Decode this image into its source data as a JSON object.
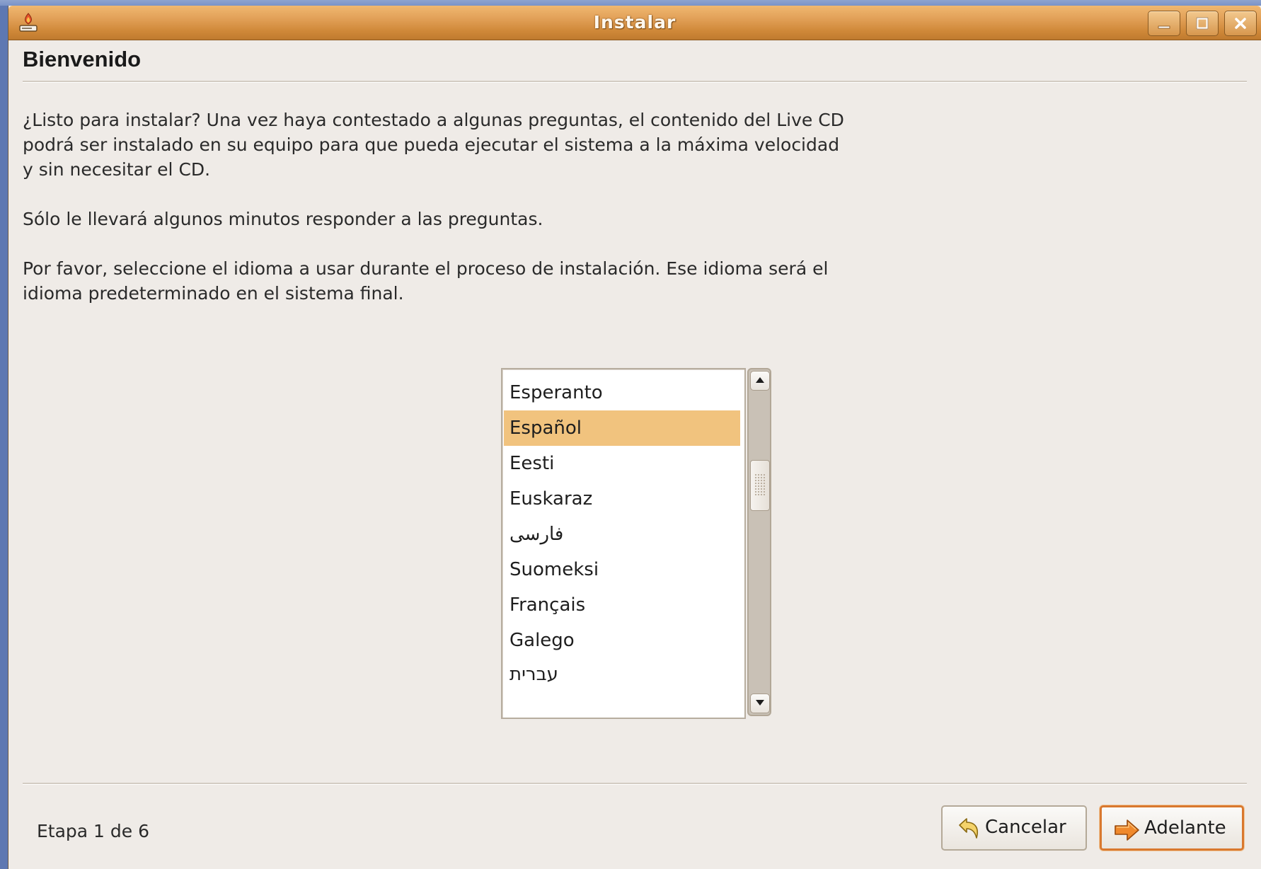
{
  "window": {
    "title": "Instalar"
  },
  "header": {
    "page_title": "Bienvenido"
  },
  "intro": {
    "paragraph1_line1": "¿Listo para instalar? Una vez haya contestado a algunas preguntas, el contenido del Live CD",
    "paragraph1_line2": "podrá ser instalado en su equipo para que pueda ejecutar el sistema a la máxima velocidad",
    "paragraph1_line3": "y sin necesitar el CD.",
    "paragraph2": "Sólo le llevará algunos minutos responder a las preguntas.",
    "paragraph3_line1": "Por favor, seleccione el idioma a usar durante el proceso de instalación. Ese idioma será el",
    "paragraph3_line2": "idioma predeterminado en el sistema final."
  },
  "language_list": {
    "selected": "Español",
    "items": [
      "Esperanto",
      "Español",
      "Eesti",
      "Euskaraz",
      "فارسی",
      "Suomeksi",
      "Français",
      "Galego",
      "עברית"
    ]
  },
  "footer": {
    "step_label": "Etapa 1 de 6",
    "cancel_label": "Cancelar",
    "forward_label": "Adelante"
  },
  "colors": {
    "titlebar": "#d8944a",
    "window_bg": "#efebe7",
    "selection": "#f1c37e",
    "default_button_border": "#d9782e",
    "desktop": "#5e78b2"
  },
  "icons": [
    "installer-icon",
    "minimize-icon",
    "maximize-icon",
    "close-icon",
    "scroll-up-icon",
    "scroll-down-icon",
    "cancel-undo-arrow-icon",
    "forward-arrow-icon"
  ]
}
